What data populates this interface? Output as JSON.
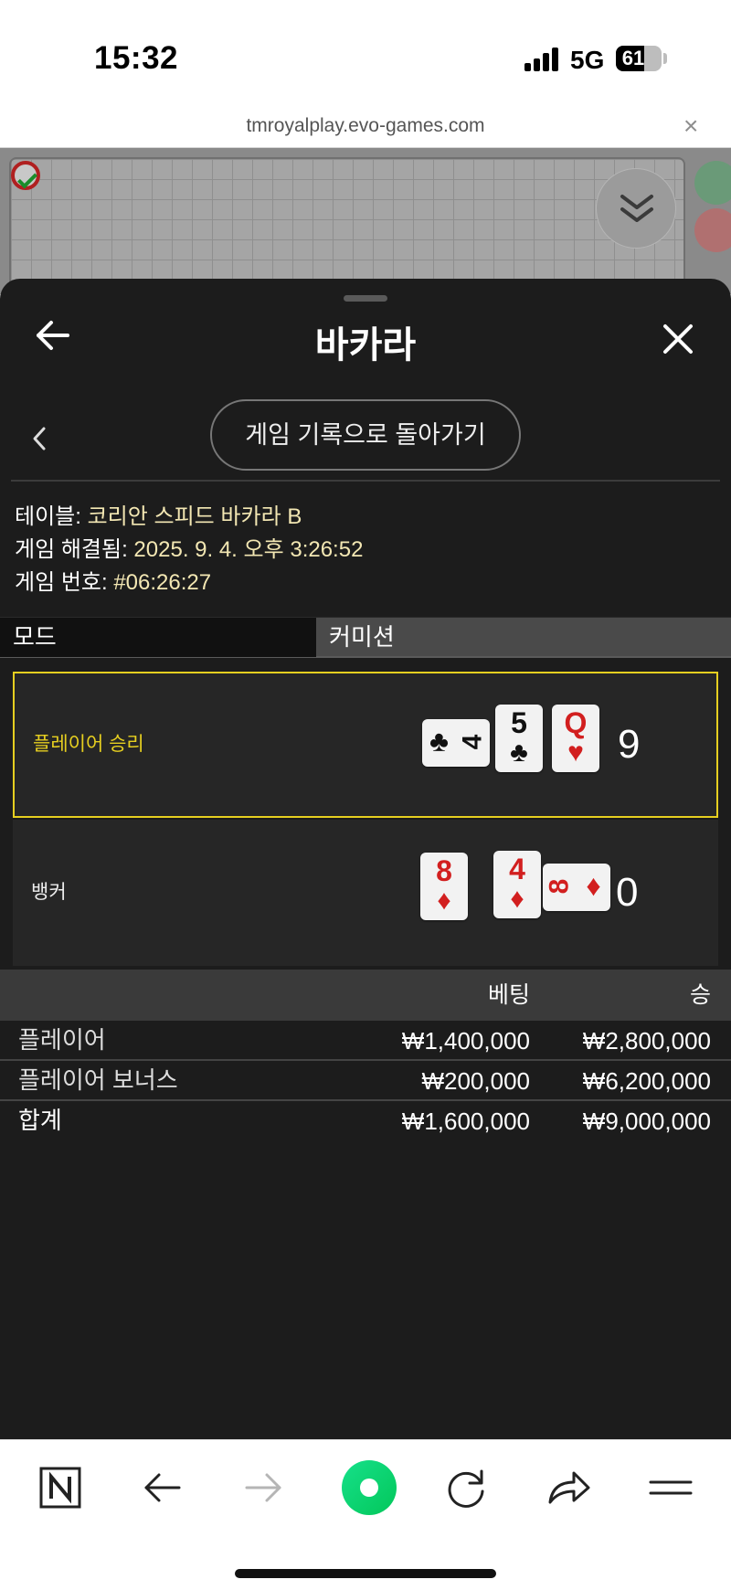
{
  "status_bar": {
    "time": "15:32",
    "network": "5G",
    "battery": "61",
    "battery_level": 0.61
  },
  "browser": {
    "url": "tmroyalplay.evo-games.com",
    "close_glyph": "×"
  },
  "sheet": {
    "title": "바카라",
    "back_to_history": "게임 기록으로 돌아가기",
    "table_label": "테이블:",
    "table_value": "코리안 스피드 바카라 B",
    "resolved_label": "게임 해결됨:",
    "resolved_value": "2025. 9. 4. 오후 3:26:52",
    "game_no_label": "게임 번호:",
    "game_no_value": "#06:26:27"
  },
  "tabs": {
    "mode": "모드",
    "commission": "커미션"
  },
  "results": {
    "player": {
      "label": "플레이어 승리",
      "score": "9",
      "cards": [
        {
          "rank": "4",
          "suit": "♣",
          "color": "black",
          "rotated": true
        },
        {
          "rank": "5",
          "suit": "♣",
          "color": "black",
          "rotated": false
        },
        {
          "rank": "Q",
          "suit": "♥",
          "color": "red",
          "rotated": false
        }
      ]
    },
    "banker": {
      "label": "뱅커",
      "score": "0",
      "cards": [
        {
          "rank": "8",
          "suit": "♦",
          "color": "red",
          "rotated": false
        },
        {
          "rank": "4",
          "suit": "♦",
          "color": "red",
          "rotated": false
        },
        {
          "rank": "8",
          "suit": "♦",
          "color": "red",
          "rotated": true
        }
      ]
    }
  },
  "bets": {
    "header_bet": "베팅",
    "header_win": "승",
    "rows": [
      {
        "name": "플레이어",
        "bet": "₩1,400,000",
        "win": "₩2,800,000"
      },
      {
        "name": "플레이어 보너스",
        "bet": "₩200,000",
        "win": "₩6,200,000"
      }
    ],
    "total": {
      "name": "합계",
      "bet": "₩1,600,000",
      "win": "₩9,000,000"
    }
  },
  "colors": {
    "sheet_bg": "#1c1c1c",
    "win_accent": "#e6cf20",
    "card_red": "#d21f1f",
    "brand_green": "#03c75a"
  },
  "icons": {
    "toolbar": [
      "naver-n-icon",
      "back-arrow-icon",
      "forward-arrow-icon",
      "green-home-icon",
      "reload-icon",
      "share-icon",
      "menu-icon"
    ]
  }
}
